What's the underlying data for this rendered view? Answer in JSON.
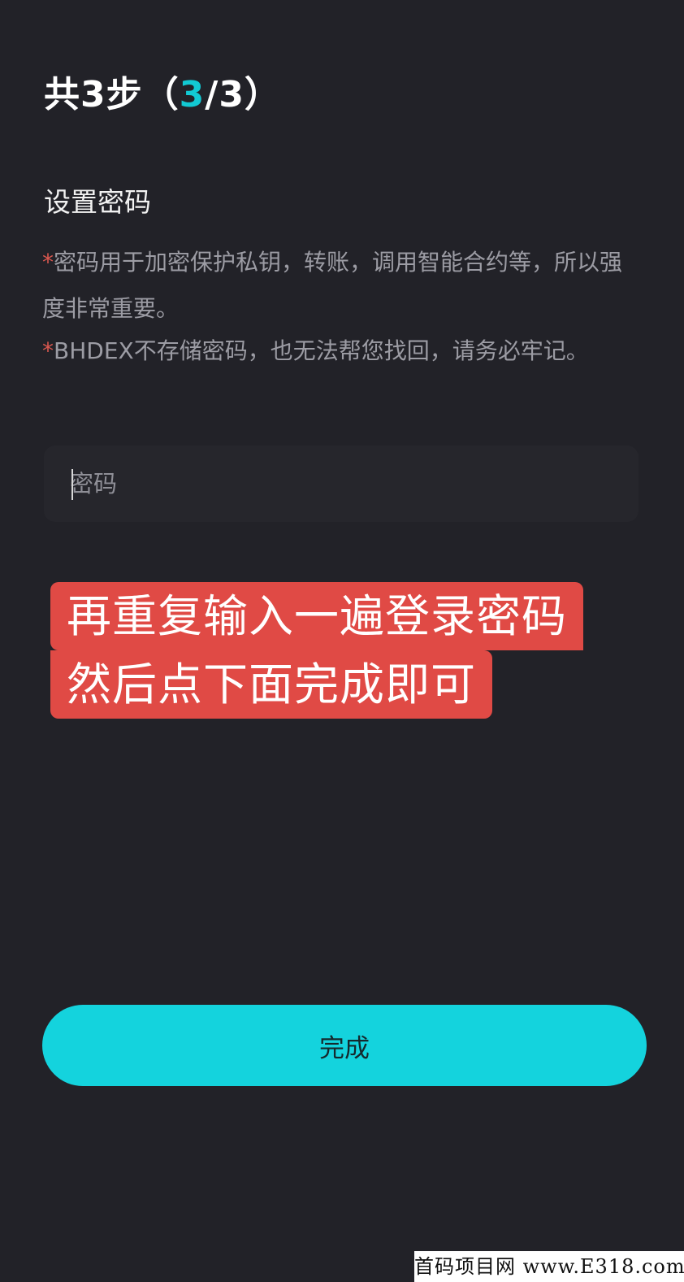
{
  "header": {
    "step_prefix": "共3步（",
    "current_step": "3",
    "step_suffix": "/3）"
  },
  "section": {
    "title": "设置密码"
  },
  "notices": [
    {
      "marker": "*",
      "text": "密码用于加密保护私钥，转账，调用智能合约等，所以强度非常重要。"
    },
    {
      "marker": "*",
      "text": "BHDEX不存储密码，也无法帮您找回，请务必牢记。"
    }
  ],
  "password_field": {
    "placeholder": "密码",
    "value": ""
  },
  "overlay_caption": {
    "lines": [
      "再重复输入一遍登录密码",
      "然后点下面完成即可"
    ]
  },
  "buttons": {
    "done_label": "完成"
  },
  "watermark": {
    "text": "首码项目网  www.E318.com"
  },
  "colors": {
    "background": "#222228",
    "accent": "#14d3dd",
    "step_highlight": "#12c9d3",
    "required_star": "#d9574f",
    "caption_background": "#e04a45"
  }
}
